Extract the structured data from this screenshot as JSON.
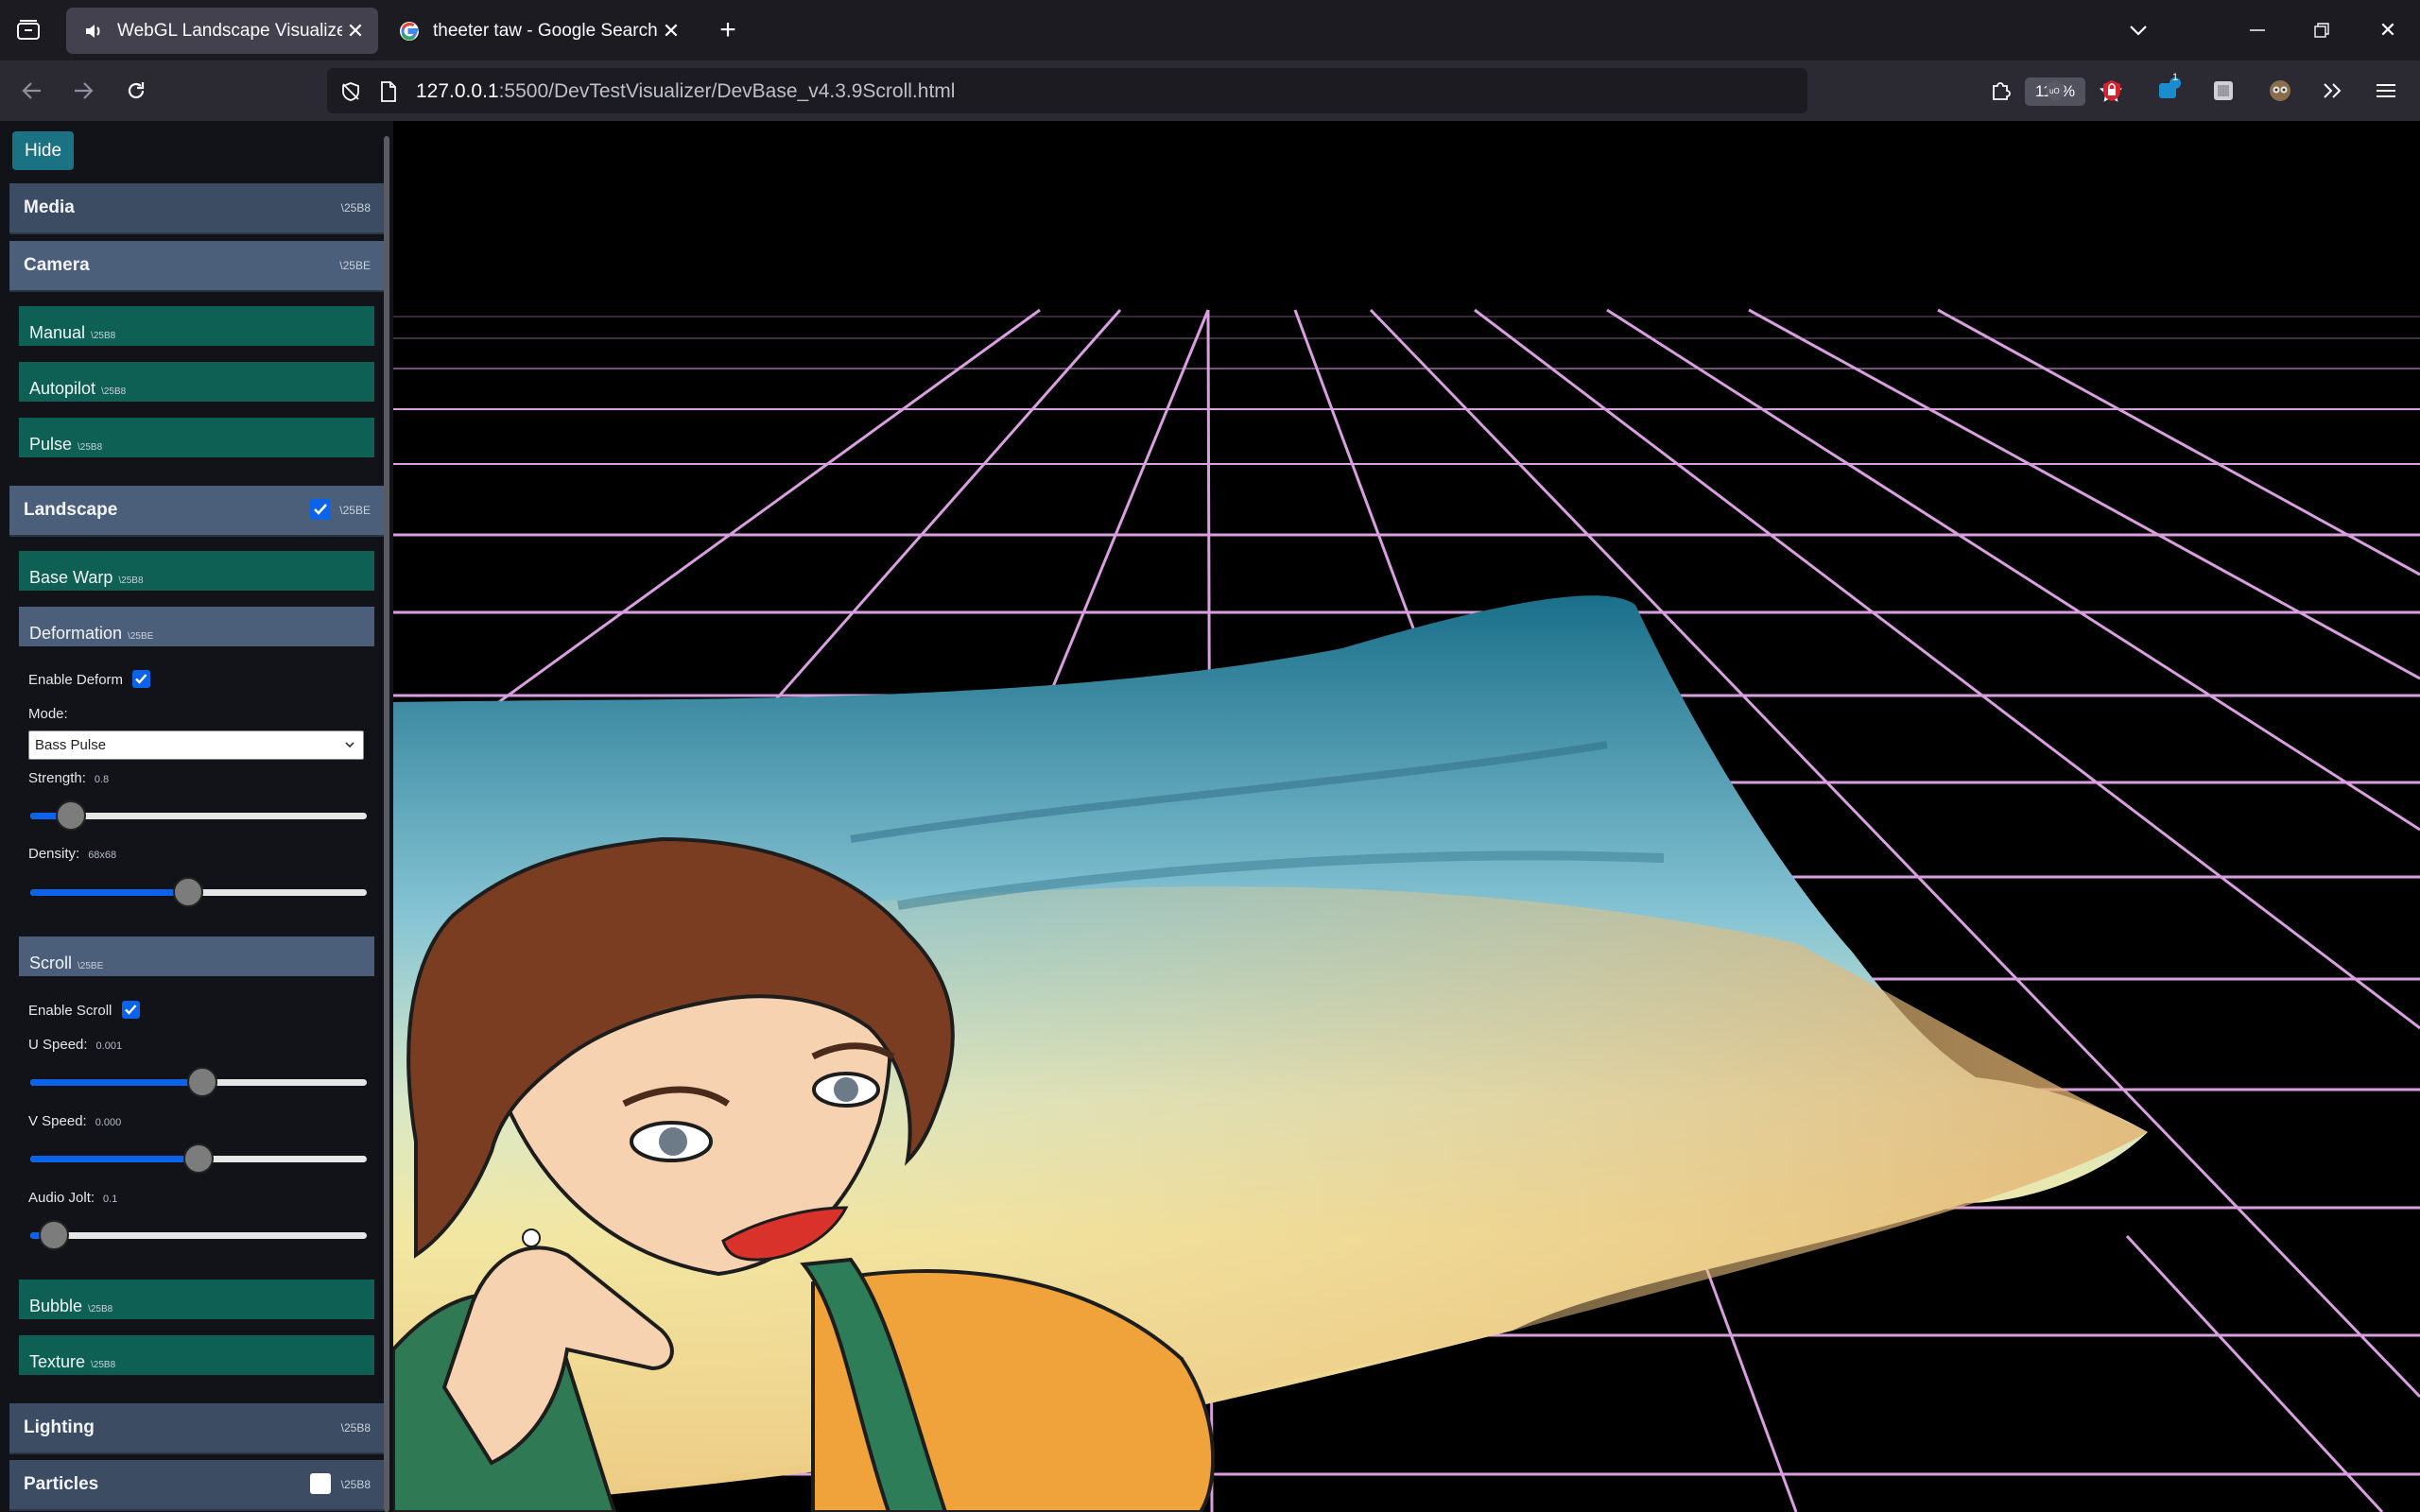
{
  "browser": {
    "tabs": [
      {
        "title": "WebGL Landscape Visualizer - I",
        "active": true,
        "icon": "speaker-icon"
      },
      {
        "title": "theeter taw - Google Search",
        "active": false,
        "icon": "google-icon"
      }
    ],
    "new_tab": "+",
    "url_host": "127.0.0.1",
    "url_rest": ":5500/DevTestVisualizer/DevBase_v4.3.9Scroll.html",
    "zoom": "110%",
    "extension_badge": "1"
  },
  "panel": {
    "hide_label": "Hide",
    "media": {
      "label": "Media",
      "code": "\\25B8"
    },
    "camera": {
      "label": "Camera",
      "code": "\\25BE",
      "manual": {
        "label": "Manual",
        "code": "\\25B8"
      },
      "autopilot": {
        "label": "Autopilot",
        "code": "\\25B8"
      },
      "pulse": {
        "label": "Pulse",
        "code": "\\25B8"
      }
    },
    "landscape": {
      "label": "Landscape",
      "code": "\\25BE",
      "checked": true,
      "base_warp": {
        "label": "Base Warp",
        "code": "\\25B8"
      },
      "deformation": {
        "label": "Deformation",
        "code": "\\25BE"
      },
      "enable_deform": {
        "label": "Enable Deform",
        "checked": true
      },
      "mode": {
        "label": "Mode:",
        "value": "Bass Pulse"
      },
      "strength": {
        "label": "Strength:",
        "value": "0.8",
        "fraction": 0.12
      },
      "density": {
        "label": "Density:",
        "value": "68x68",
        "fraction": 0.47
      },
      "scroll": {
        "label": "Scroll",
        "code": "\\25BE"
      },
      "enable_scroll": {
        "label": "Enable Scroll",
        "checked": true
      },
      "u_speed": {
        "label": "U Speed:",
        "value": "0.001",
        "fraction": 0.51
      },
      "v_speed": {
        "label": "V Speed:",
        "value": "0.000",
        "fraction": 0.5
      },
      "audio_jolt": {
        "label": "Audio Jolt:",
        "value": "0.1",
        "fraction": 0.07
      },
      "bubble": {
        "label": "Bubble",
        "code": "\\25B8"
      },
      "texture": {
        "label": "Texture",
        "code": "\\25B8"
      }
    },
    "lighting": {
      "label": "Lighting",
      "code": "\\25B8"
    },
    "particles": {
      "label": "Particles",
      "code": "\\25B8",
      "checked": false
    }
  },
  "colors": {
    "grid": "#e6a8ee",
    "section": "#3b4c63",
    "subsection": "#0e5f54",
    "accent": "#0a63e8",
    "hide_button": "#1a7282"
  }
}
